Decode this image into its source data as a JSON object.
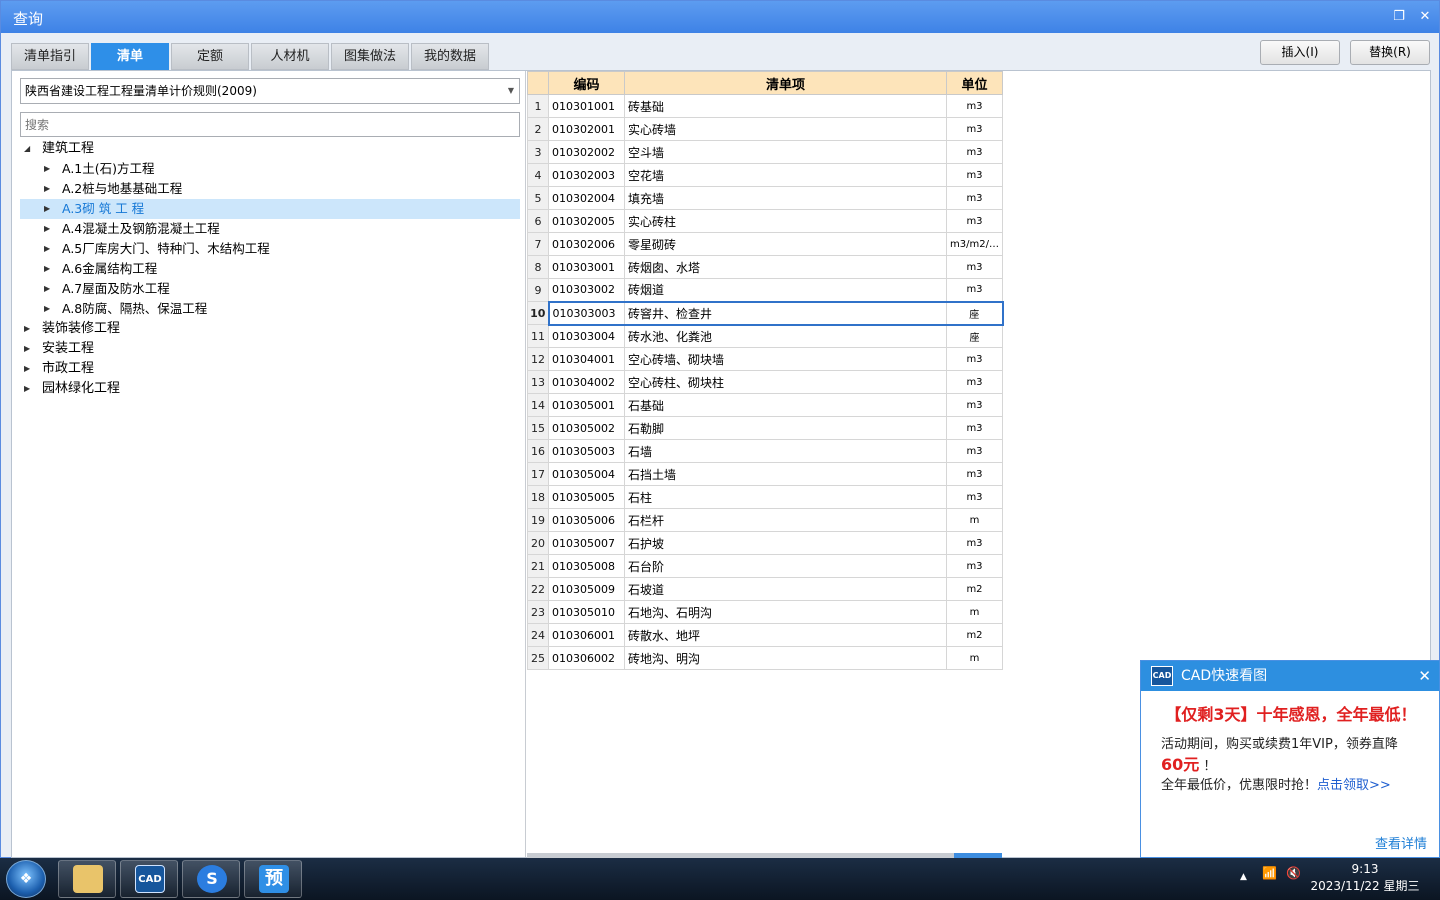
{
  "window": {
    "title": "查询",
    "restore_icon": "restore-icon",
    "close_icon": "close-icon"
  },
  "tabs": [
    "清单指引",
    "清单",
    "定额",
    "人材机",
    "图集做法",
    "我的数据"
  ],
  "active_tab": 1,
  "actions": {
    "insert": "插入(I)",
    "replace": "替换(R)"
  },
  "left": {
    "standard": "陕西省建设工程工程量清单计价规则(2009)",
    "search_placeholder": "搜索",
    "tree": [
      {
        "label": "建筑工程",
        "level": 0,
        "expanded": true
      },
      {
        "label": "A.1土(石)方工程",
        "level": 1
      },
      {
        "label": "A.2桩与地基基础工程",
        "level": 1
      },
      {
        "label": "A.3砌 筑 工 程",
        "level": 1,
        "selected": true
      },
      {
        "label": "A.4混凝土及钢筋混凝土工程",
        "level": 1
      },
      {
        "label": "A.5厂库房大门、特种门、木结构工程",
        "level": 1
      },
      {
        "label": "A.6金属结构工程",
        "level": 1
      },
      {
        "label": "A.7屋面及防水工程",
        "level": 1
      },
      {
        "label": "A.8防腐、隔热、保温工程",
        "level": 1
      },
      {
        "label": "装饰装修工程",
        "level": 0
      },
      {
        "label": "安装工程",
        "level": 0
      },
      {
        "label": "市政工程",
        "level": 0
      },
      {
        "label": "园林绿化工程",
        "level": 0
      }
    ]
  },
  "grid": {
    "headers": {
      "code": "编码",
      "item": "清单项",
      "unit": "单位"
    },
    "current_row": 10,
    "rows": [
      {
        "n": "1",
        "code": "010301001",
        "item": "砖基础",
        "unit": "m3"
      },
      {
        "n": "2",
        "code": "010302001",
        "item": "实心砖墙",
        "unit": "m3"
      },
      {
        "n": "3",
        "code": "010302002",
        "item": "空斗墙",
        "unit": "m3"
      },
      {
        "n": "4",
        "code": "010302003",
        "item": "空花墙",
        "unit": "m3"
      },
      {
        "n": "5",
        "code": "010302004",
        "item": "填充墙",
        "unit": "m3"
      },
      {
        "n": "6",
        "code": "010302005",
        "item": "实心砖柱",
        "unit": "m3"
      },
      {
        "n": "7",
        "code": "010302006",
        "item": "零星砌砖",
        "unit": "m3/m2/…"
      },
      {
        "n": "8",
        "code": "010303001",
        "item": "砖烟囱、水塔",
        "unit": "m3"
      },
      {
        "n": "9",
        "code": "010303002",
        "item": "砖烟道",
        "unit": "m3"
      },
      {
        "n": "10",
        "code": "010303003",
        "item": "砖窨井、检查井",
        "unit": "座"
      },
      {
        "n": "11",
        "code": "010303004",
        "item": "砖水池、化粪池",
        "unit": "座"
      },
      {
        "n": "12",
        "code": "010304001",
        "item": "空心砖墙、砌块墙",
        "unit": "m3"
      },
      {
        "n": "13",
        "code": "010304002",
        "item": "空心砖柱、砌块柱",
        "unit": "m3"
      },
      {
        "n": "14",
        "code": "010305001",
        "item": "石基础",
        "unit": "m3"
      },
      {
        "n": "15",
        "code": "010305002",
        "item": "石勒脚",
        "unit": "m3"
      },
      {
        "n": "16",
        "code": "010305003",
        "item": "石墙",
        "unit": "m3"
      },
      {
        "n": "17",
        "code": "010305004",
        "item": "石挡土墙",
        "unit": "m3"
      },
      {
        "n": "18",
        "code": "010305005",
        "item": "石柱",
        "unit": "m3"
      },
      {
        "n": "19",
        "code": "010305006",
        "item": "石栏杆",
        "unit": "m"
      },
      {
        "n": "20",
        "code": "010305007",
        "item": "石护坡",
        "unit": "m3"
      },
      {
        "n": "21",
        "code": "010305008",
        "item": "石台阶",
        "unit": "m3"
      },
      {
        "n": "22",
        "code": "010305009",
        "item": "石坡道",
        "unit": "m2"
      },
      {
        "n": "23",
        "code": "010305010",
        "item": "石地沟、石明沟",
        "unit": "m"
      },
      {
        "n": "24",
        "code": "010306001",
        "item": "砖散水、地坪",
        "unit": "m2"
      },
      {
        "n": "25",
        "code": "010306002",
        "item": "砖地沟、明沟",
        "unit": "m"
      }
    ]
  },
  "popup": {
    "logo": "CAD",
    "title": "CAD快速看图",
    "headline": "【仅剩3天】十年感恩，全年最低！",
    "line1": "活动期间，购买或续费1年VIP，领券直降",
    "price": "60元",
    "price_suffix": "！",
    "line3": "全年最低价，优惠限时抢！",
    "link": "点击领取>>",
    "more": "查看详情"
  },
  "taskbar": {
    "start_icon": "windows-start-icon",
    "apps": [
      {
        "icon": "file-explorer-icon",
        "label": ""
      },
      {
        "icon": "cad-viewer-icon",
        "label": "CAD"
      },
      {
        "icon": "sogou-input-icon",
        "label": "S"
      },
      {
        "icon": "budget-app-icon",
        "label": "预"
      }
    ],
    "time": "9:13",
    "date": "2023/11/22 星期三"
  },
  "colors": {
    "title_bar": "#3e82e6",
    "active_tab": "#2e8fe8",
    "header_bg": "#fde4ba",
    "selection": "#cce6fb",
    "promo_red": "#e02020",
    "link_blue": "#1f5fd0"
  }
}
